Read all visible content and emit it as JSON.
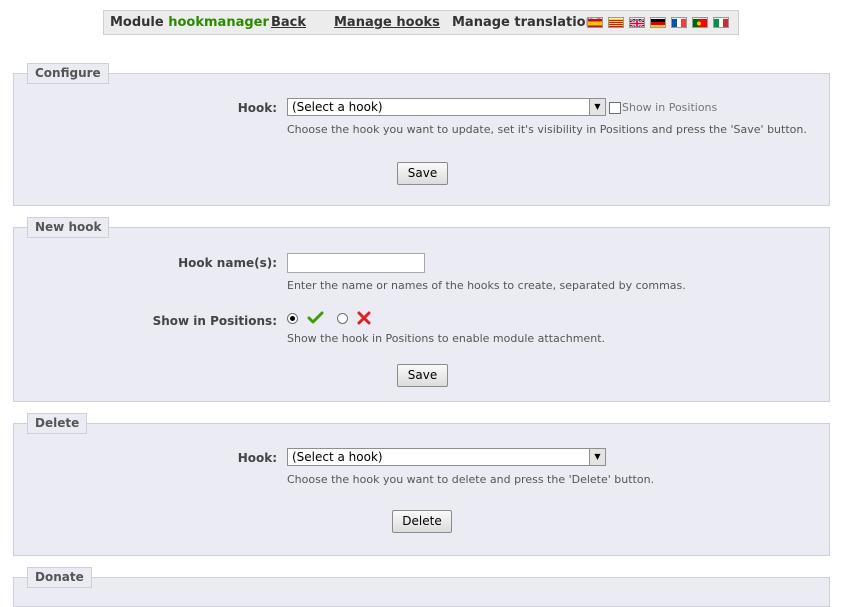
{
  "topbar": {
    "module_prefix": "Module",
    "module_name": "hookmanager",
    "back": "Back",
    "manage_hooks": "Manage hooks",
    "manage_translations": "Manage translations",
    "flags": [
      "flag-es-icon",
      "flag-ca-icon",
      "flag-gb-icon",
      "flag-de-icon",
      "flag-fr-icon",
      "flag-pt-icon",
      "flag-it-icon"
    ]
  },
  "configure": {
    "legend": "Configure",
    "hook_label": "Hook:",
    "hook_value": "(Select a hook)",
    "show_in_positions": "Show in Positions",
    "hint": "Choose the hook you want to update, set it's visibility in Positions and press the 'Save' button.",
    "save": "Save"
  },
  "new_hook": {
    "legend": "New hook",
    "name_label": "Hook name(s):",
    "name_value": "",
    "name_hint": "Enter the name or names of the hooks to create, separated by commas.",
    "positions_label": "Show in Positions:",
    "positions_selected": "yes",
    "positions_hint": "Show the hook in Positions to enable module attachment.",
    "save": "Save"
  },
  "delete": {
    "legend": "Delete",
    "hook_label": "Hook:",
    "hook_value": "(Select a hook)",
    "hint": "Choose the hook you want to delete and press the 'Delete' button.",
    "delete": "Delete"
  },
  "donate": {
    "legend": "Donate"
  },
  "colors": {
    "module_name": "#2a8a00",
    "panel_bg": "#ebebf3",
    "check_green": "#3aa000",
    "cross_red": "#e02020"
  }
}
